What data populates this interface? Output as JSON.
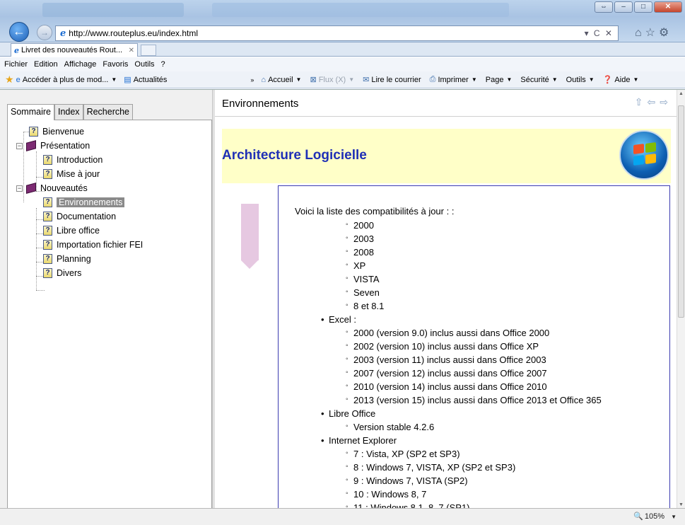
{
  "browser": {
    "url": "http://www.routeplus.eu/index.html",
    "tab_title": "Livret des nouveautés Rout...",
    "menu": [
      "Fichier",
      "Edition",
      "Affichage",
      "Favoris",
      "Outils",
      "?"
    ],
    "favorites": [
      {
        "label": "Accéder à plus de mod...",
        "icon": "ie-page-icon"
      },
      {
        "label": "Actualités",
        "icon": "feed-icon"
      }
    ],
    "commands": [
      {
        "label": "Accueil",
        "icon": "home-icon",
        "enabled": true
      },
      {
        "label": "Flux (X)",
        "icon": "rss-icon",
        "enabled": false
      },
      {
        "label": "Lire le courrier",
        "icon": "mail-icon",
        "enabled": true
      },
      {
        "label": "Imprimer",
        "icon": "printer-icon",
        "enabled": true
      },
      {
        "label": "Page",
        "icon": "",
        "enabled": true
      },
      {
        "label": "Sécurité",
        "icon": "",
        "enabled": true
      },
      {
        "label": "Outils",
        "icon": "",
        "enabled": true
      },
      {
        "label": "Aide",
        "icon": "help-icon",
        "enabled": true
      }
    ],
    "zoom": "105%"
  },
  "nav": {
    "tabs": [
      "Sommaire",
      "Index",
      "Recherche"
    ],
    "tree": [
      {
        "label": "Bienvenue",
        "type": "topic",
        "level": 0
      },
      {
        "label": "Présentation",
        "type": "book",
        "level": 0
      },
      {
        "label": "Introduction",
        "type": "topic",
        "level": 1
      },
      {
        "label": "Mise à jour",
        "type": "topic",
        "level": 1
      },
      {
        "label": "Nouveautés",
        "type": "book",
        "level": 0
      },
      {
        "label": "Environnements",
        "type": "topic",
        "level": 1,
        "selected": true
      },
      {
        "label": "Documentation",
        "type": "topic",
        "level": 1
      },
      {
        "label": "Libre office",
        "type": "topic",
        "level": 1
      },
      {
        "label": "Importation fichier FEI",
        "type": "topic",
        "level": 1
      },
      {
        "label": "Planning",
        "type": "topic",
        "level": 1
      },
      {
        "label": "Divers",
        "type": "topic",
        "level": 1
      }
    ]
  },
  "content": {
    "header": "Environnements",
    "banner_title": "Architecture Logicielle",
    "intro": "Voici la liste des compatibilités à jour : :",
    "lines": [
      {
        "level": 2,
        "text": "2000"
      },
      {
        "level": 2,
        "text": "2003"
      },
      {
        "level": 2,
        "text": "2008"
      },
      {
        "level": 2,
        "text": "XP"
      },
      {
        "level": 2,
        "text": "VISTA"
      },
      {
        "level": 2,
        "text": "Seven"
      },
      {
        "level": 2,
        "text": "8 et 8.1"
      },
      {
        "level": 1,
        "text": "Excel :"
      },
      {
        "level": 2,
        "text": "2000 (version 9.0) inclus aussi dans Office 2000"
      },
      {
        "level": 2,
        "text": "2002 (version 10) inclus aussi dans Office XP"
      },
      {
        "level": 2,
        "text": "2003 (version 11) inclus aussi dans Office 2003"
      },
      {
        "level": 2,
        "text": "2007 (version 12) inclus aussi dans Office 2007"
      },
      {
        "level": 2,
        "text": "2010 (version 14) inclus aussi dans Office 2010"
      },
      {
        "level": 2,
        "text": "2013 (version 15) inclus aussi dans Office 2013 et Office 365"
      },
      {
        "level": 1,
        "text": "Libre Office"
      },
      {
        "level": 2,
        "text": "Version stable 4.2.6"
      },
      {
        "level": 1,
        "text": "Internet Explorer"
      },
      {
        "level": 2,
        "text": "7 : Vista, XP (SP2 et SP3)"
      },
      {
        "level": 2,
        "text": "8 : Windows 7, VISTA, XP (SP2 et SP3)"
      },
      {
        "level": 2,
        "text": "9 : Windows 7, VISTA (SP2)"
      },
      {
        "level": 2,
        "text": "10 : Windows 8, 7"
      },
      {
        "level": 2,
        "text": "11 : Windows 8.1, 8, 7 (SP1)."
      }
    ]
  }
}
